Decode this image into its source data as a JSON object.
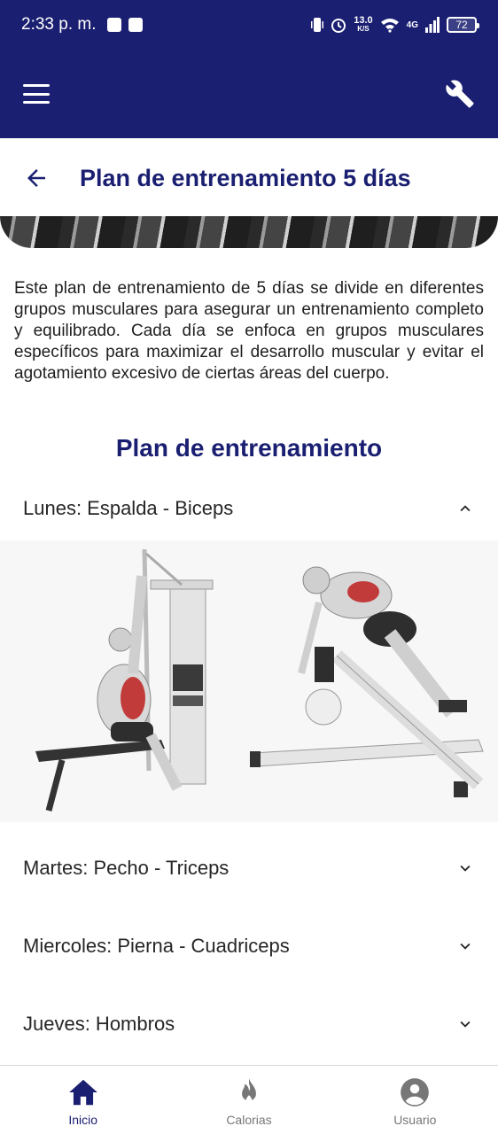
{
  "status_bar": {
    "time": "2:33 p. m.",
    "speed_value": "13.0",
    "speed_unit": "K/S",
    "network": "4G",
    "battery": "72"
  },
  "header": {
    "menu_icon": "hamburger-menu-icon",
    "settings_icon": "wrench-icon"
  },
  "page": {
    "back_icon": "arrow-left-icon",
    "title": "Plan de entrenamiento 5 días"
  },
  "intro_text": "Este plan de entrenamiento de 5 días se divide en diferentes grupos musculares para asegurar un entrenamiento completo y equilibrado. Cada día se enfoca en grupos musculares específicos para maximizar el desarrollo muscular y evitar el agotamiento excesivo de ciertas áreas del cuerpo.",
  "section_title": "Plan de entrenamiento",
  "plan_days": [
    {
      "label": "Lunes: Espalda - Biceps",
      "expanded": true,
      "image": "back-exercise-illustration"
    },
    {
      "label": "Martes: Pecho - Triceps",
      "expanded": false
    },
    {
      "label": "Miercoles: Pierna - Cuadriceps",
      "expanded": false
    },
    {
      "label": "Jueves: Hombros",
      "expanded": false
    }
  ],
  "bottom_nav": {
    "items": [
      {
        "label": "Inicio",
        "icon": "home-icon",
        "active": true
      },
      {
        "label": "Calorias",
        "icon": "flame-icon",
        "active": false
      },
      {
        "label": "Usuario",
        "icon": "user-circle-icon",
        "active": false
      }
    ]
  },
  "colors": {
    "primary": "#1a1f71",
    "inactive": "#777777",
    "background": "#ffffff"
  }
}
